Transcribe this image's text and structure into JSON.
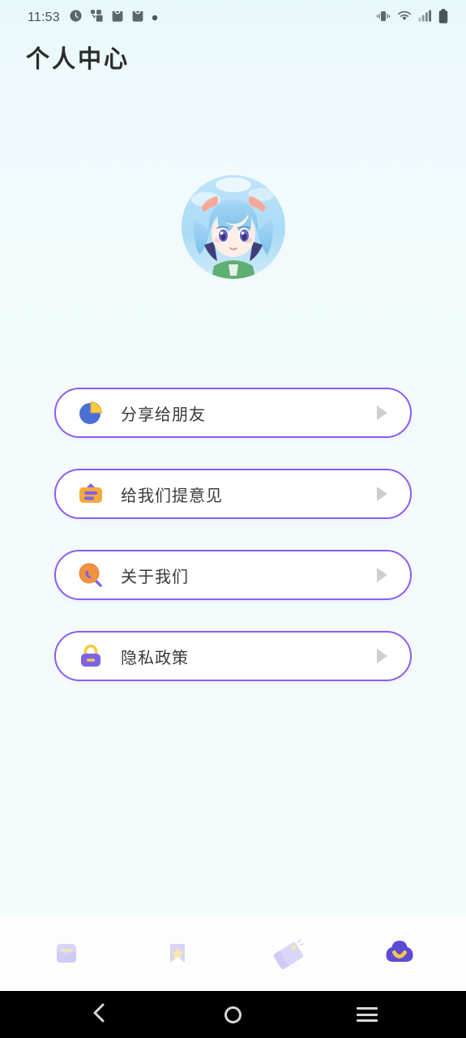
{
  "status_bar": {
    "time": "11:53",
    "left_icons": [
      "clock-icon",
      "share-network-icon",
      "shopping-bag-icon",
      "shopping-bag-icon",
      "dot-icon"
    ],
    "right_icons": [
      "vibrate-icon",
      "wifi-icon",
      "signal-icon",
      "battery-icon"
    ]
  },
  "header": {
    "title": "个人中心"
  },
  "profile": {
    "avatar_alt": "anime-character-avatar"
  },
  "menu": {
    "items": [
      {
        "label": "分享给朋友",
        "icon": "pie-share-icon",
        "arrow": "chevron-right-icon"
      },
      {
        "label": "给我们提意见",
        "icon": "feedback-card-icon",
        "arrow": "chevron-right-icon"
      },
      {
        "label": "关于我们",
        "icon": "about-magnifier-icon",
        "arrow": "chevron-right-icon"
      },
      {
        "label": "隐私政策",
        "icon": "lock-icon",
        "arrow": "chevron-right-icon"
      }
    ]
  },
  "tabbar": {
    "items": [
      {
        "icon": "inbox-icon",
        "active": false
      },
      {
        "icon": "bookmark-star-icon",
        "active": false
      },
      {
        "icon": "tags-icon",
        "active": false
      },
      {
        "icon": "cloud-profile-icon",
        "active": true
      }
    ]
  },
  "system_nav": {
    "back": "back-chevron-icon",
    "home": "home-circle-icon",
    "recents": "recents-menu-icon"
  },
  "colors": {
    "background": "#f2fafc",
    "accent_purple": "#8b5cf6",
    "card_white": "#ffffff",
    "label_text": "#3a3a3a",
    "title_text": "#2c2c2c",
    "arrow_gray": "#cdcdd4",
    "tab_active": "#5b4bd6",
    "tab_inactive": "#cdcbf2",
    "icon_orange": "#f5a24b",
    "icon_yellow": "#f7c948",
    "icon_blue": "#4a6fd4"
  }
}
